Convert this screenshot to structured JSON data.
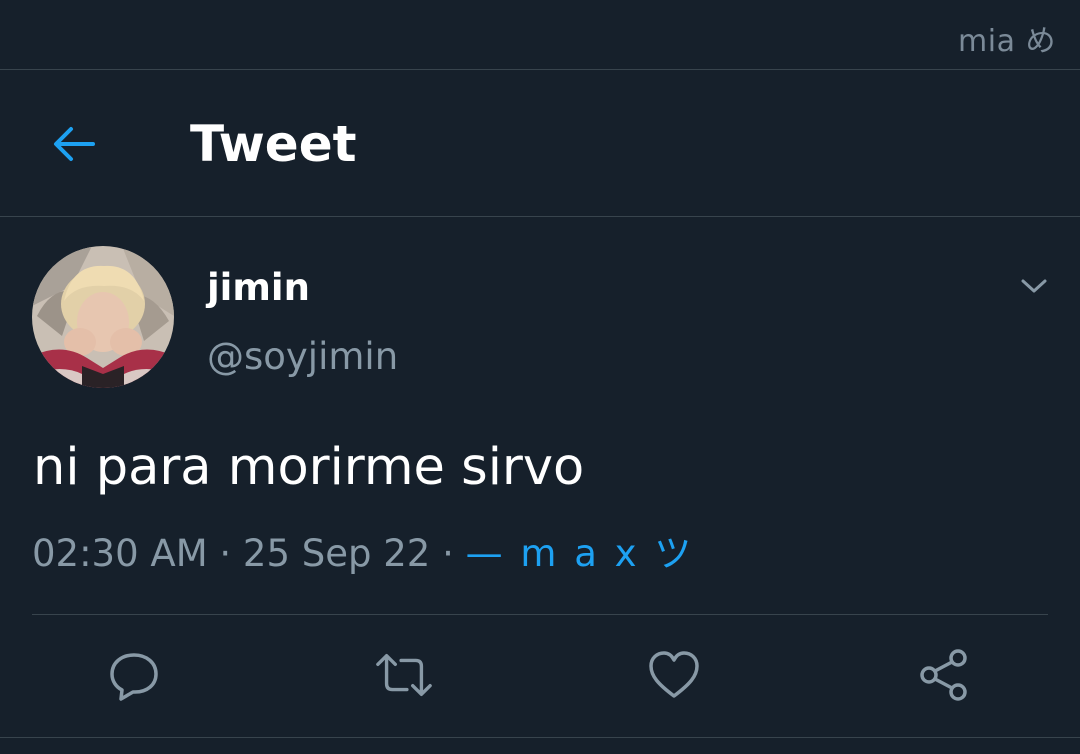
{
  "status_bar": {
    "watermark": "mia め"
  },
  "header": {
    "title": "Tweet",
    "back_icon": "arrow-left-icon"
  },
  "tweet": {
    "author": {
      "name": "jimin",
      "handle": "@soyjimin"
    },
    "text": "ni para morirme sirvo",
    "time": "02:30 AM",
    "separator_1": " · ",
    "date": "25 Sep 22",
    "separator_2": " · ",
    "source": "— m a x ツ"
  },
  "actions": [
    {
      "icon": "reply-icon"
    },
    {
      "icon": "retweet-icon"
    },
    {
      "icon": "like-icon"
    },
    {
      "icon": "share-icon"
    }
  ],
  "colors": {
    "background": "#16202b",
    "divider": "#38444d",
    "accent": "#1da1f2",
    "secondary_text": "#8899a6",
    "primary_text": "#ffffff"
  }
}
